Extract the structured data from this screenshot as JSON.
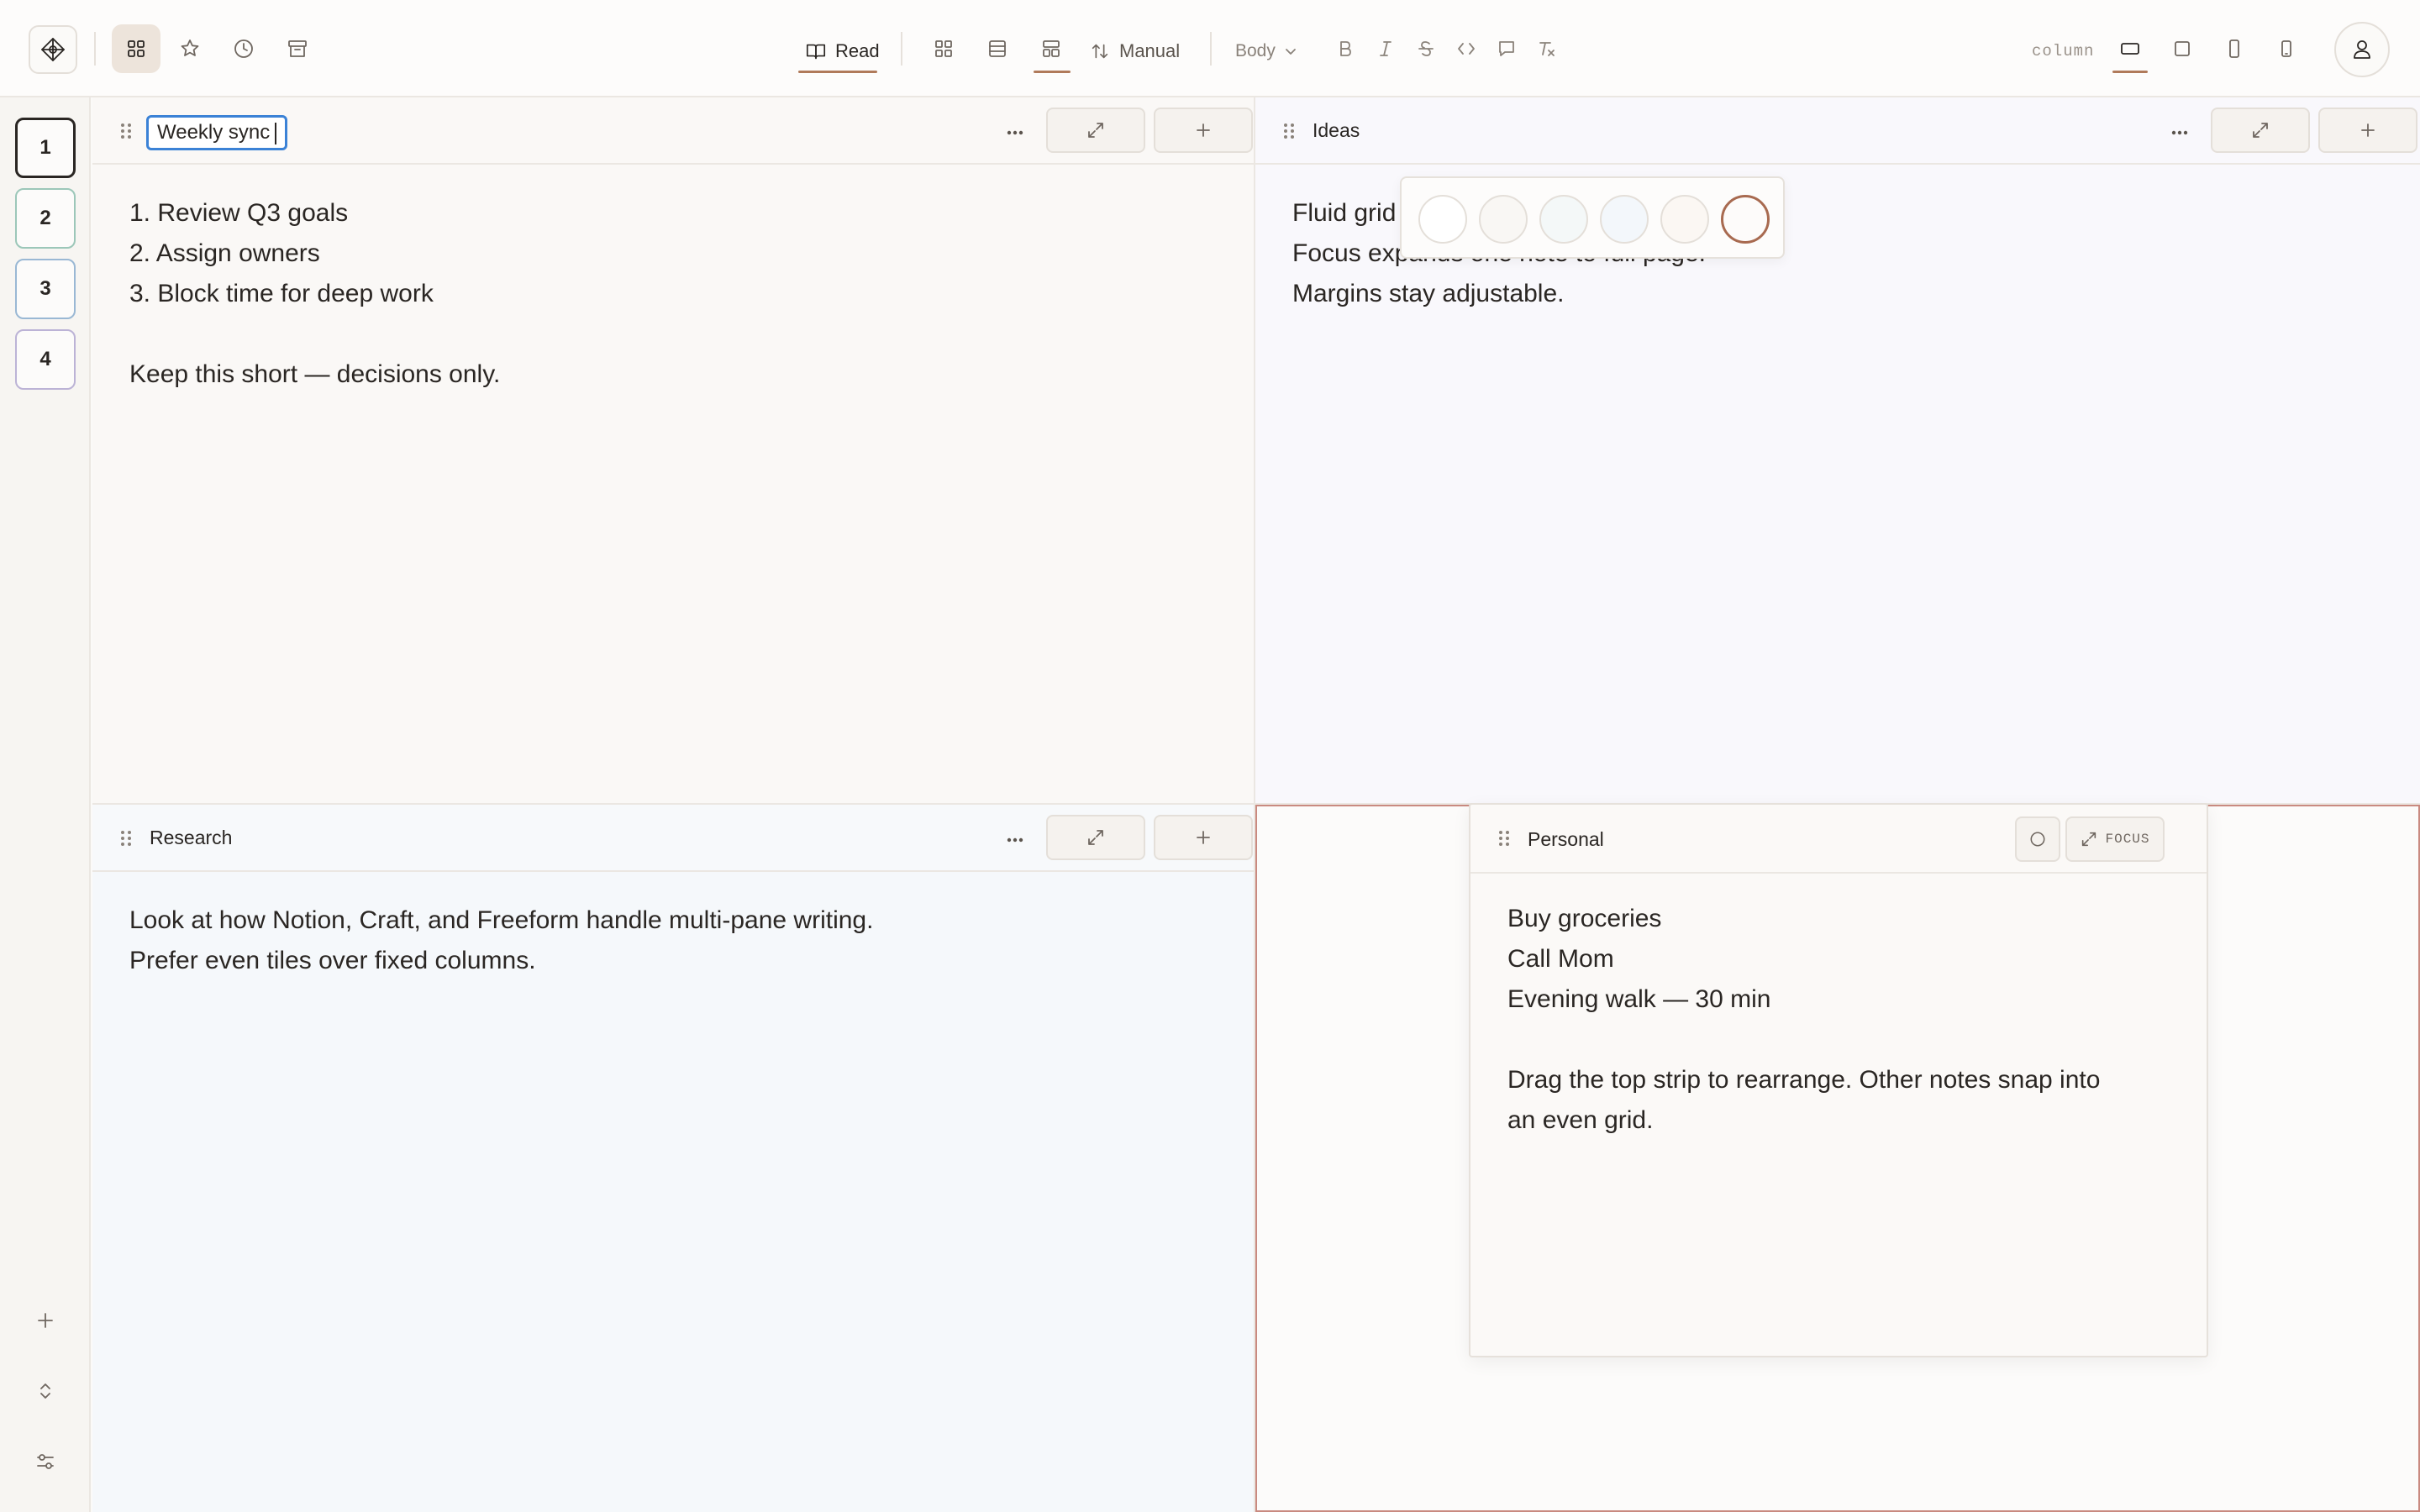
{
  "toolbar": {
    "read_label": "Read",
    "manual_label": "Manual",
    "body_label": "Body",
    "column_label": "column"
  },
  "sidebar": {
    "pages": [
      "1",
      "2",
      "3",
      "4"
    ]
  },
  "notes": {
    "weekly": {
      "title": "Weekly sync",
      "lines": [
        "1. Review Q3 goals",
        "2. Assign owners",
        "3. Block time for deep work",
        "",
        "Keep this short — decisions only."
      ]
    },
    "ideas": {
      "title": "Ideas",
      "lines": [
        "Fluid grid",
        "Focus expands one note to full page.",
        "Margins stay adjustable."
      ]
    },
    "research": {
      "title": "Research",
      "lines": [
        "Look at how Notion, Craft, and Freeform handle multi-pane writing.",
        "Prefer even tiles over fixed columns."
      ]
    },
    "personal": {
      "title": "Personal",
      "focus_label": "FOCUS",
      "lines": [
        "Buy groceries",
        "Call Mom",
        "Evening walk — 30 min",
        "",
        "Drag the top strip to rearrange. Other notes snap into",
        "an even grid."
      ]
    }
  },
  "colors": {
    "accent": "#b07a5a",
    "selection": "#3b82d6",
    "swatches": [
      "#ffffff",
      "#f9f7f4",
      "#f4f8f8",
      "#f3f7fb",
      "#fbf7f3",
      "#fdfbfa"
    ]
  }
}
